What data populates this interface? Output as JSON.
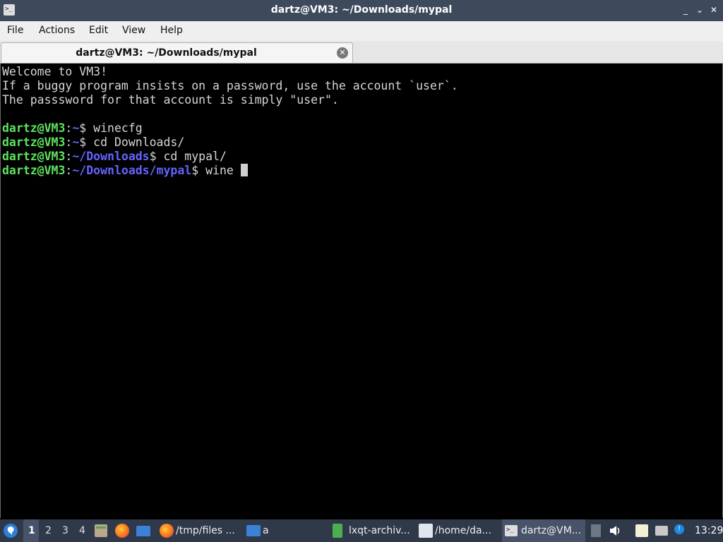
{
  "window": {
    "title": "dartz@VM3: ~/Downloads/mypal",
    "controls": [
      "_",
      "⌄",
      "✕"
    ]
  },
  "menu": [
    "File",
    "Actions",
    "Edit",
    "View",
    "Help"
  ],
  "tab": {
    "label": "dartz@VM3: ~/Downloads/mypal"
  },
  "terminal": {
    "motd": [
      "Welcome to VM3!",
      "If a buggy program insists on a password, use the account `user`.",
      "The passsword for that account is simply \"user\"."
    ],
    "prompt_user": "dartz@VM3",
    "commands": [
      {
        "path": "~",
        "cmd": "winecfg"
      },
      {
        "path": "~",
        "cmd": "cd Downloads/"
      },
      {
        "path": "~/Downloads",
        "cmd": "cd mypal/"
      },
      {
        "path": "~/Downloads/mypal",
        "cmd": "wine "
      }
    ]
  },
  "taskbar": {
    "workspaces": [
      "1",
      "2",
      "3",
      "4"
    ],
    "tasks": [
      {
        "label": "/tmp/files ..."
      },
      {
        "label": "a"
      },
      {
        "label": "lxqt-archiv..."
      },
      {
        "label": "/home/da..."
      },
      {
        "label": "dartz@VM..."
      }
    ],
    "clock": "13:29"
  },
  "colors": {
    "titlebar": "#3d4a5c",
    "taskbar": "#30394a",
    "prompt_user": "#5ee35e",
    "prompt_path": "#6464ff"
  }
}
